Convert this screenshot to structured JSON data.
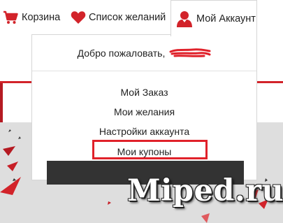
{
  "nav": {
    "cart_label": "Корзина",
    "wishlist_label": "Список желаний",
    "account_label": "Мой Аккаунт"
  },
  "dropdown": {
    "welcome_text": "Добро пожаловать,",
    "items": [
      {
        "label": "Мой Заказ"
      },
      {
        "label": "Мои желания"
      },
      {
        "label": "Настройки аккаунта"
      },
      {
        "label": "Мои купоны"
      }
    ]
  },
  "watermark": "Miped.ru",
  "icons": {
    "cart": "cart-icon",
    "wishlist": "heart-icon",
    "account": "user-icon"
  },
  "colors": {
    "accent": "#e0212a",
    "dark_bar": "#333333",
    "background_panel": "#dedede"
  }
}
